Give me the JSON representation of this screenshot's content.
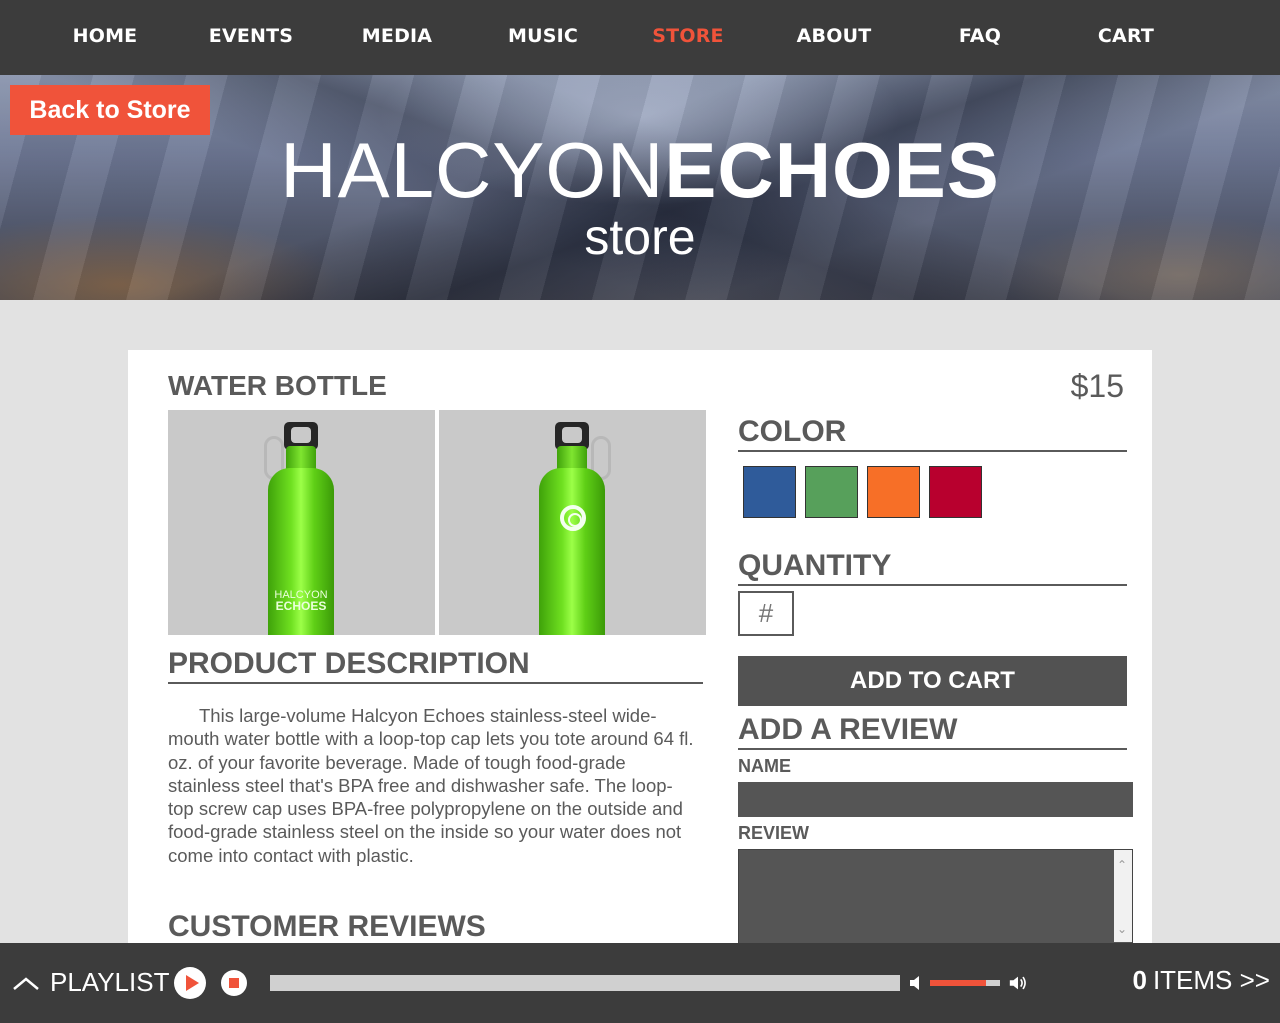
{
  "nav": {
    "items": [
      {
        "label": "HOME",
        "active": false
      },
      {
        "label": "EVENTS",
        "active": false
      },
      {
        "label": "MEDIA",
        "active": false
      },
      {
        "label": "MUSIC",
        "active": false
      },
      {
        "label": "STORE",
        "active": true
      },
      {
        "label": "ABOUT",
        "active": false
      },
      {
        "label": "FAQ",
        "active": false
      },
      {
        "label": "CART",
        "active": false
      }
    ]
  },
  "hero": {
    "back_label": "Back to Store",
    "logo_light": "HALCYON",
    "logo_bold": "ECHOES",
    "subtitle": "store"
  },
  "product": {
    "title": "WATER BOTTLE",
    "price": "$15",
    "images": [
      {
        "icon": "green-water-bottle-front",
        "print_top": "HALCYON",
        "print_bottom": "ECHOES"
      },
      {
        "icon": "green-water-bottle-back-ring-logo"
      }
    ],
    "description_heading": "PRODUCT DESCRIPTION",
    "description": "This large-volume Halcyon Echoes stainless-steel wide-mouth water bottle with a loop-top cap lets you tote around 64 fl. oz. of your favorite beverage. Made of tough food-grade stainless steel that's BPA free and dishwasher safe. The loop-top screw cap uses BPA-free polypropylene on the outside and food-grade stainless steel on the inside so your water does not come into contact with plastic.",
    "reviews_heading": "CUSTOMER REVIEWS"
  },
  "options": {
    "color_heading": "COLOR",
    "colors": [
      "#2f5b9a",
      "#57a05b",
      "#f76f27",
      "#b8002e"
    ],
    "quantity_heading": "QUANTITY",
    "quantity_placeholder": "#",
    "add_to_cart_label": "ADD TO CART"
  },
  "review_form": {
    "heading": "ADD A REVIEW",
    "name_label": "NAME",
    "review_label": "REVIEW"
  },
  "player": {
    "playlist_label": "PLAYLIST",
    "progress": 0,
    "volume": 0.8,
    "items_count": "0",
    "items_label": "ITEMS >>"
  },
  "colors": {
    "accent": "#f0533a",
    "dark_bar": "#3c3c3c"
  }
}
